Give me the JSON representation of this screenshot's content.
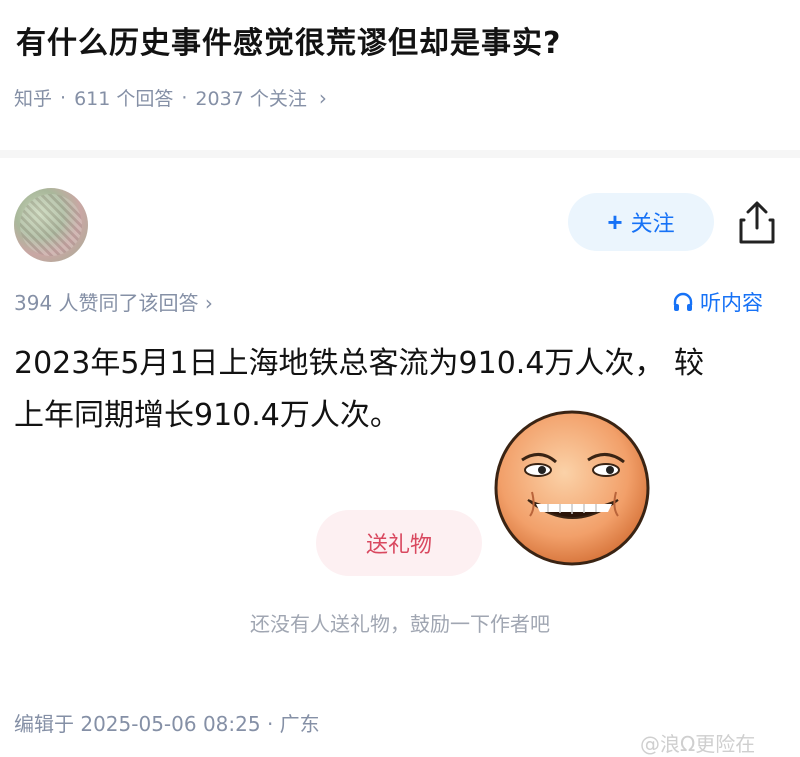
{
  "question": {
    "title": "有什么历史事件感觉很荒谬但却是事实?",
    "source": "知乎",
    "answers": "611 个回答",
    "followers": "2037 个关注"
  },
  "answer": {
    "follow_label": "关注",
    "upvote_text": "394 人赞同了该回答",
    "listen_label": "听内容",
    "line1": "2023年5月1日上海地铁总客流为910.4万人次， 较",
    "line2": "上年同期增长910.4万人次。",
    "gift_label": "送礼物",
    "gift_note": "还没有人送礼物，鼓励一下作者吧",
    "edit_info": "编辑于 2025-05-06 08:25 · 广东"
  },
  "watermark": "@浪Ω更险在",
  "icons": {
    "share": "share-icon",
    "headphones": "headphones-icon",
    "chevron": "chevron-right-icon",
    "emoji": "grinning-face-emoji"
  },
  "colors": {
    "accent": "#1772f6",
    "gift": "#d9485f",
    "meta": "#8590a6"
  }
}
